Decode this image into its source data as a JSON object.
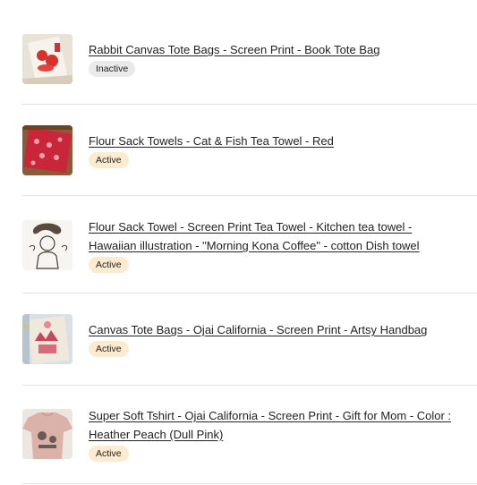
{
  "listings": [
    {
      "title_lines": [
        "Rabbit Canvas Tote Bags - Screen Print - Book Tote Bag"
      ],
      "status": "Inactive",
      "thumbnail_icon": "rabbit-tote-thumbnail"
    },
    {
      "title_lines": [
        "Flour Sack Towels - Cat & Fish Tea Towel - Red"
      ],
      "status": "Active",
      "thumbnail_icon": "red-tea-towel-thumbnail"
    },
    {
      "title_lines": [
        "Flour Sack Towel - Screen Print Tea Towel - Kitchen tea towel -",
        "Hawaiian illustration - \"Morning Kona Coffee\" - cotton Dish towel"
      ],
      "status": "Active",
      "thumbnail_icon": "kona-coffee-towel-thumbnail"
    },
    {
      "title_lines": [
        "Canvas Tote Bags - Ojai California - Screen Print - Artsy Handbag"
      ],
      "status": "Active",
      "thumbnail_icon": "ojai-tote-thumbnail"
    },
    {
      "title_lines": [
        "Super Soft Tshirt - Ojai California - Screen Print - Gift for Mom - Color :",
        "Heather Peach (Dull Pink)"
      ],
      "status": "Active",
      "thumbnail_icon": "peach-tshirt-thumbnail"
    }
  ],
  "colors": {
    "badge_active": "#fdebcf",
    "badge_inactive": "#eaeaea",
    "divider": "#e1e1e1",
    "text": "#222222"
  }
}
